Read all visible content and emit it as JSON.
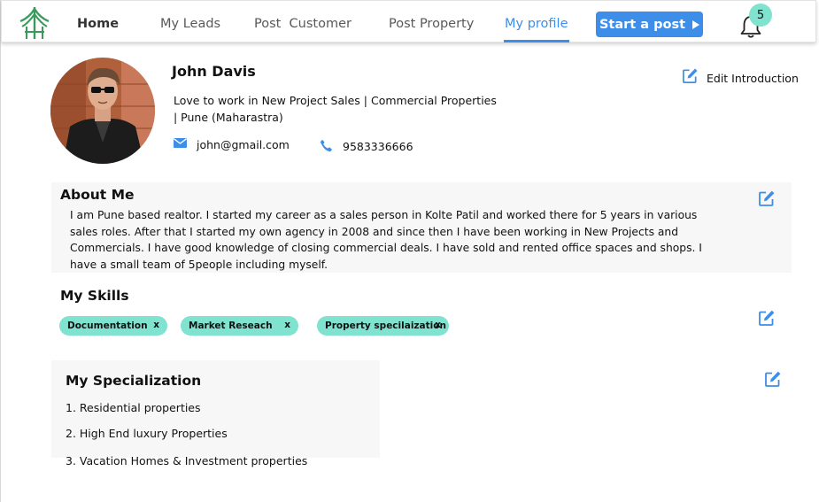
{
  "nav": {
    "items": [
      {
        "label": "Home"
      },
      {
        "label": "My Leads"
      },
      {
        "label": "Post  Customer"
      },
      {
        "label": "Post Property"
      },
      {
        "label": "My profile"
      }
    ],
    "active_index": 4,
    "post_button_label": "Start a post",
    "notification_count": "5"
  },
  "profile": {
    "name": "John Davis",
    "headline_line1": "Love to work in New Project Sales | Commercial Properties",
    "headline_line2": "| Pune (Maharastra)",
    "email": "john@gmail.com",
    "phone": "9583336666",
    "edit_intro_label": "Edit Introduction"
  },
  "about": {
    "title": "About Me",
    "text": "I am Pune based realtor. I started my career as a sales person in Kolte Patil and worked there for 5 years in various sales roles. After that I started my own agency in 2008 and since then I have been working in New Projects and Commercials. I have good knowledge of closing commercial deals. I have sold and rented office spaces and shops. I have a small team of 5people including myself."
  },
  "skills": {
    "title": "My Skills",
    "chips": [
      {
        "label": "Documentation",
        "remove": "x"
      },
      {
        "label": "Market Reseach",
        "remove": "x"
      },
      {
        "label": "Property specilaization",
        "remove": "x"
      }
    ]
  },
  "specialization": {
    "title": "My Specialization",
    "items": [
      "1. Residential properties",
      "2. High End luxury Properties",
      "3. Vacation Homes & Investment properties"
    ]
  },
  "colors": {
    "accent": "#3d8ee8",
    "chip": "#7fe3cf",
    "badge": "#80e3cf",
    "logo": "#3a9a5c",
    "section_bg": "#f7f7f7"
  },
  "icons": {
    "logo": "house-tree-logo",
    "notification": "bell-icon",
    "email": "mail-icon",
    "phone": "phone-icon",
    "edit": "edit-icon"
  }
}
